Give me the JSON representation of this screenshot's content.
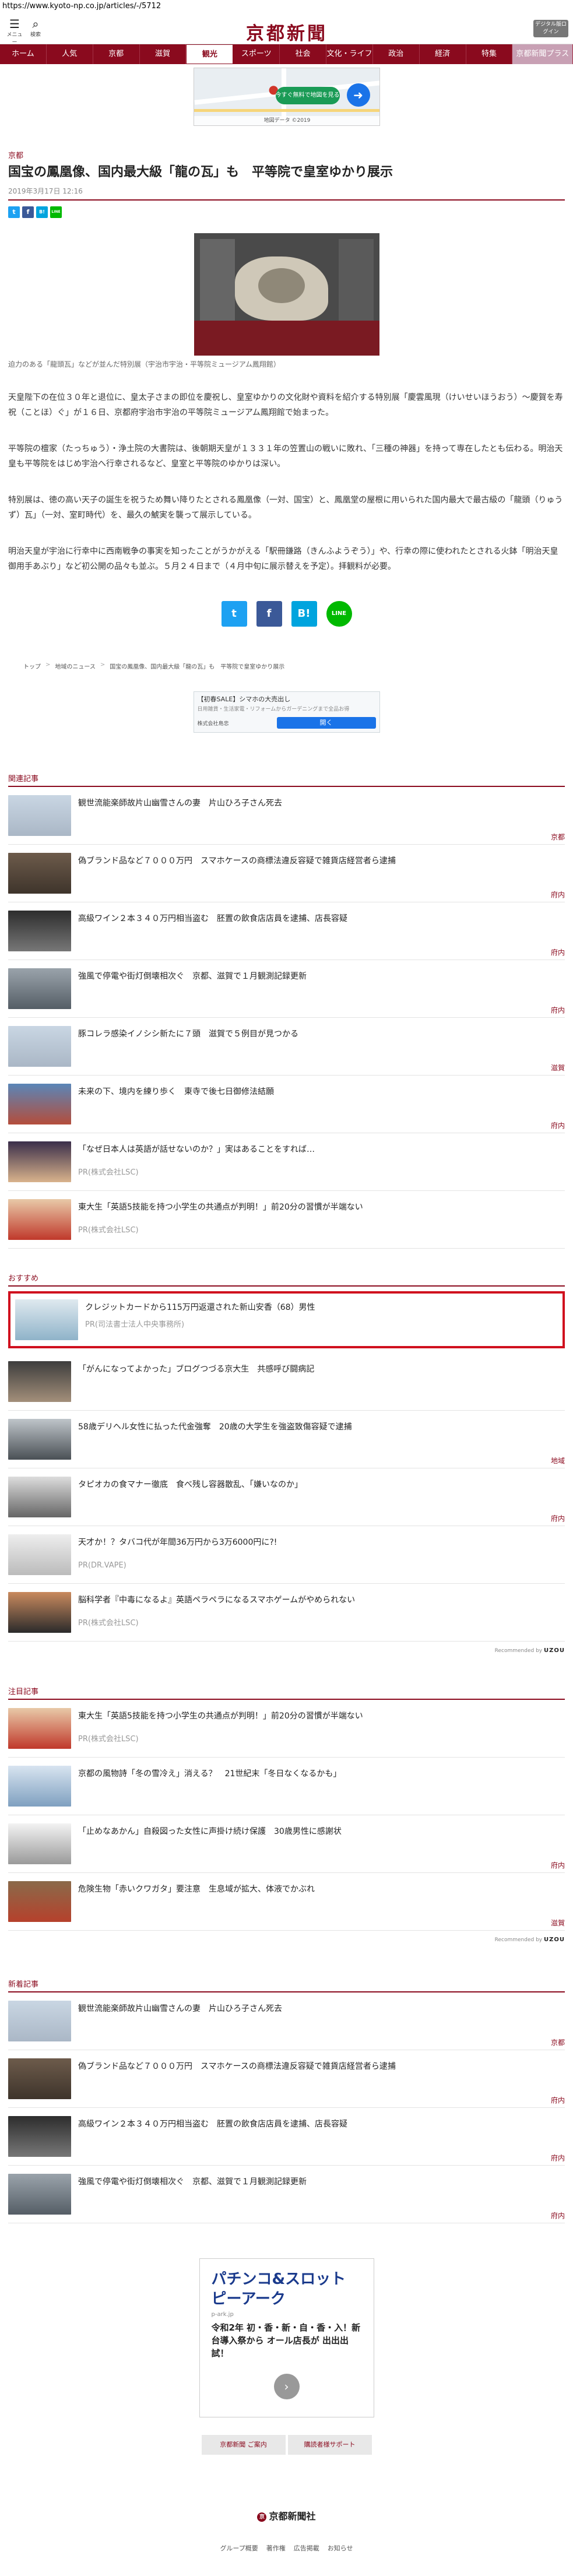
{
  "url": "https://www.kyoto-np.co.jp/articles/-/5712",
  "header": {
    "menu_label": "メニュー",
    "search_label": "検索",
    "logo": "京都新聞",
    "digital_label": "デジタル版ログイン"
  },
  "nav": [
    "ホーム",
    "人気",
    "京都",
    "滋賀",
    "観光",
    "スポーツ",
    "社会",
    "文化・ライフ",
    "政治",
    "経済",
    "特集",
    "京都新聞プラス"
  ],
  "nav_active": "観光",
  "map_ad": {
    "cta": "今すぐ無料で地図を見る",
    "caption": "地図データ ©2019"
  },
  "article": {
    "section": "京都",
    "headline": "国宝の鳳凰像、国内最大級「龍の瓦」も　平等院で皇室ゆかり展示",
    "date": "2019年3月17日 12:16",
    "photo_caption": "迫力のある「龍頭瓦」などが並んだ特別展（宇治市宇治・平等院ミュージアム鳳翔館）",
    "paragraphs": [
      "天皇陛下の在位３０年と退位に、皇太子さまの即位を慶祝し、皇室ゆかりの文化財や資料を紹介する特別展「慶雲風現（けいせいほうおう）～慶賀を寿祝（ことほ）ぐ」が１６日、京都府宇治市宇治の平等院ミュージアム鳳翔館で始まった。",
      "平等院の檀家（たっちゅう）・浄土院の大書院は、後朝期天皇が１３３１年の笠置山の戦いに敗れ、「三種の神器」を持って専在したとも伝わる。明治天皇も平等院をはじめ宇治へ行幸されるなど、皇室と平等院のゆかりは深い。",
      "特別展は、徳の高い天子の誕生を祝うため舞い降りたとされる鳳凰像（一対、国宝）と、鳳凰堂の屋根に用いられた国内最大で最古級の「龍頭（りゅうず）瓦」（一対、室町時代）を、最久の鯱実を襲って展示している。",
      "明治天皇が宇治に行幸中に西南戦争の事実を知ったことがうかがえる「駅冊鎌路（きんふようぞう）」や、行幸の際に使われたとされる火鉢「明治天皇御用手あぶり」など初公開の品々も並ぶ。５月２４日まで（４月中旬に展示替えを予定）。拝観料が必要。"
    ]
  },
  "share": {
    "twitter": "t",
    "facebook": "f",
    "hatena": "B!",
    "line": "LINE"
  },
  "breadcrumb": [
    "トップ",
    "地域のニュース",
    "国宝の鳳凰像、国内最大級「龍の瓦」も　平等院で皇室ゆかり展示"
  ],
  "promo": {
    "title": "【初春SALE】シマホの大売出し",
    "subtitle": "日用雑貨・生活家電・リフォームからガーデニングまで全品お得",
    "shop": "株式会社島忠",
    "cta": "開く"
  },
  "related": {
    "title": "関連記事",
    "items": [
      {
        "text": "観世流能楽師故片山幽雪さんの妻　片山ひろ子さん死去",
        "tag": "京都",
        "sub": ""
      },
      {
        "text": "偽ブランド品など７０００万円　スマホケースの商標法違反容疑で雑貨店経営者ら逮捕",
        "tag": "府内",
        "sub": ""
      },
      {
        "text": "高級ワイン２本３４０万円相当盗む　胚置の飲食店店員を逮捕、店長容疑",
        "tag": "府内",
        "sub": ""
      },
      {
        "text": "強風で停電や街灯倒壊相次ぐ　京都、滋賀で１月観測記録更新",
        "tag": "府内",
        "sub": ""
      },
      {
        "text": "豚コレラ感染イノシシ新たに７頭　滋賀で５例目が見つかる",
        "tag": "滋賀",
        "sub": ""
      },
      {
        "text": "未来の下、境内を練り歩く　東寺で後七日御修法結願",
        "tag": "府内",
        "sub": ""
      },
      {
        "text": "「なぜ日本人は英語が話せないのか？」実はあることをすれば…",
        "tag": "",
        "sub": "PR(株式会社LSC)"
      },
      {
        "text": "東大生「英語5技能を持つ小学生の共通点が判明！」前20分の習慣が半端ない",
        "tag": "",
        "sub": "PR(株式会社LSC)"
      }
    ]
  },
  "osusume": {
    "title": "おすすめ",
    "items": [
      {
        "text": "クレジットカードから115万円返還された新山安香（68）男性",
        "tag": "",
        "sub": "PR(司法書士法人中央事務所)"
      },
      {
        "text": "「がんになってよかった」ブログつづる京大生　共感呼び闘病記",
        "tag": "",
        "sub": ""
      },
      {
        "text": "58歳デリヘル女性に払った代金強奪　20歳の大学生を強盗致傷容疑で逮捕",
        "tag": "地域",
        "sub": ""
      },
      {
        "text": "タピオカの食マナー徹底　食べ残し容器散乱、「嫌いなのか」",
        "tag": "府内",
        "sub": ""
      },
      {
        "text": "天才か！？タバコ代が年間36万円から3万6000円に?!",
        "tag": "",
        "sub": "PR(DR.VAPE)"
      },
      {
        "text": "脳科学者『中毒になるよ』英語ペラペラになるスマホゲームがやめられない",
        "tag": "",
        "sub": "PR(株式会社LSC)"
      }
    ],
    "powered_label": "Recommended by",
    "powered_brand": "UZOU"
  },
  "chuumoku": {
    "title": "注目記事",
    "items": [
      {
        "text": "東大生「英語5技能を持つ小学生の共通点が判明！」前20分の習慣が半端ない",
        "tag": "",
        "sub": "PR(株式会社LSC)"
      },
      {
        "text": "京都の風物詩「冬の雪冷え」消える？　21世紀末「冬日なくなるかも」",
        "tag": "",
        "sub": ""
      },
      {
        "text": "「止めなあかん」自殺図った女性に声掛け続け保護　30歳男性に感謝状",
        "tag": "府内",
        "sub": ""
      },
      {
        "text": "危険生物「赤いクワガタ」要注意　生息域が拡大、体液でかぶれ",
        "tag": "滋賀",
        "sub": ""
      }
    ],
    "powered_label": "Recommended by",
    "powered_brand": "UZOU"
  },
  "newest": {
    "title": "新着記事",
    "items": [
      {
        "text": "観世流能楽師故片山幽雪さんの妻　片山ひろ子さん死去",
        "tag": "京都",
        "sub": ""
      },
      {
        "text": "偽ブランド品など７０００万円　スマホケースの商標法違反容疑で雑貨店経営者ら逮捕",
        "tag": "府内",
        "sub": ""
      },
      {
        "text": "高級ワイン２本３４０万円相当盗む　胚置の飲食店店員を逮捕、店長容疑",
        "tag": "府内",
        "sub": ""
      },
      {
        "text": "強風で停電や街灯倒壊相次ぐ　京都、滋賀で１月観測記録更新",
        "tag": "府内",
        "sub": ""
      }
    ]
  },
  "pachinko": {
    "title": "パチンコ&スロット ピーアーク",
    "domain": "p-ark.jp",
    "body": "令和2年 初・香・新・自・香・入！新台導入祭から オール店長が 出出出試！"
  },
  "footer": {
    "buttons": [
      "京都新聞 ご案内",
      "購読者様サポート"
    ],
    "logo": "京都新聞社",
    "logo_mark": "京",
    "links": [
      "グループ概要",
      "著作権",
      "広告掲載",
      "お知らせ"
    ]
  },
  "colors": {
    "brand": "#8a0a1e",
    "highlight": "#d0101e",
    "twitter": "#1da1f2",
    "facebook": "#3b5998",
    "hatena": "#00a4de",
    "line": "#00b900"
  }
}
